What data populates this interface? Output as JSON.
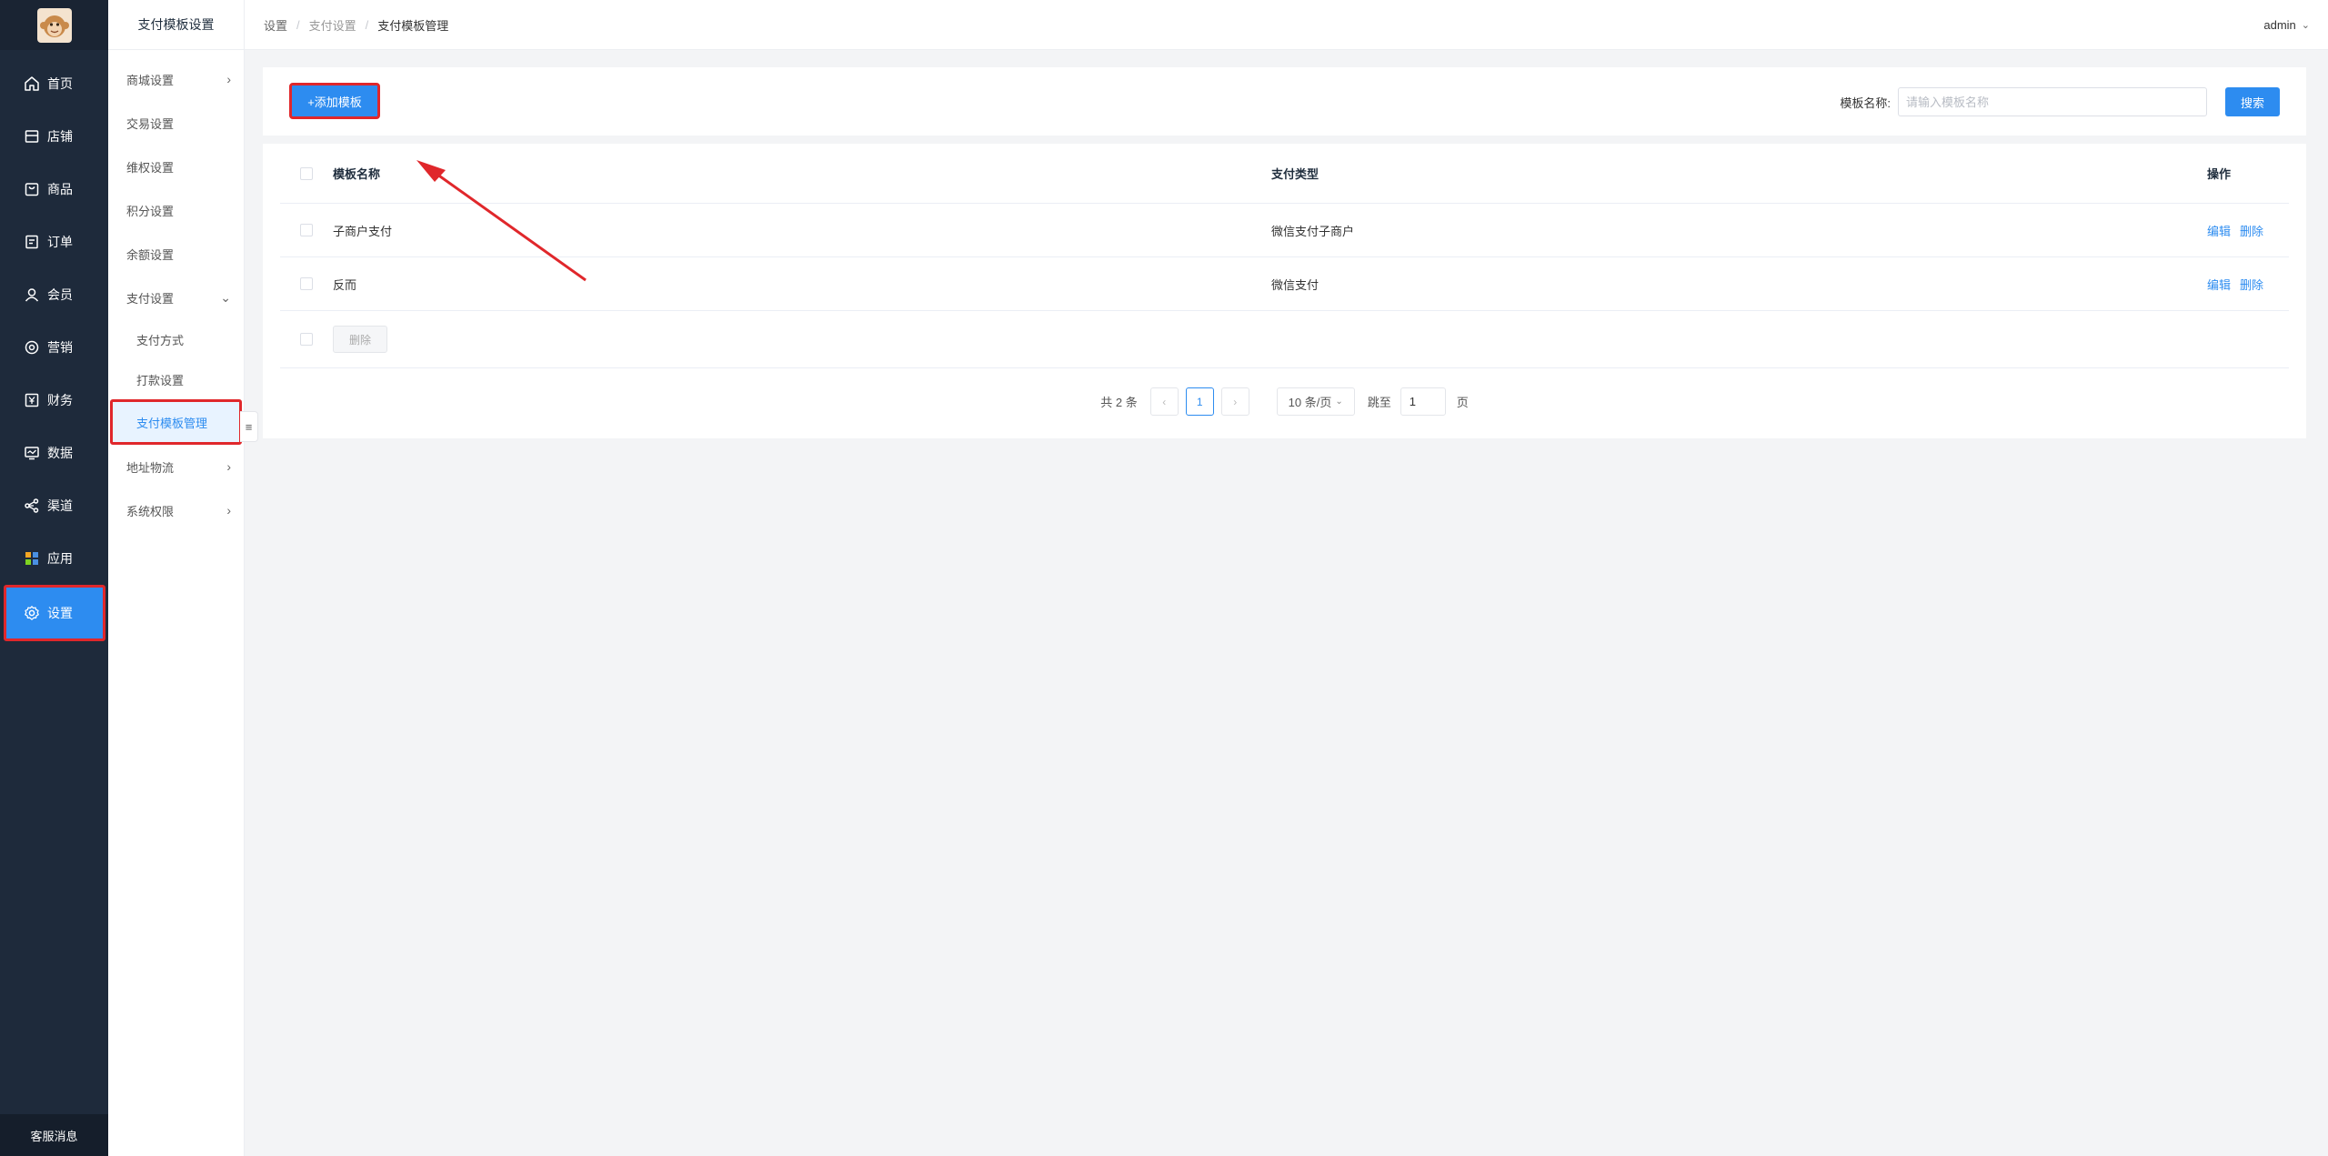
{
  "app": {
    "avatar_alt": "avatar",
    "footer_label": "客服消息"
  },
  "nav": {
    "items": [
      {
        "label": "首页",
        "icon": "home-icon"
      },
      {
        "label": "店铺",
        "icon": "store-icon"
      },
      {
        "label": "商品",
        "icon": "goods-icon"
      },
      {
        "label": "订单",
        "icon": "order-icon"
      },
      {
        "label": "会员",
        "icon": "member-icon"
      },
      {
        "label": "营销",
        "icon": "marketing-icon"
      },
      {
        "label": "财务",
        "icon": "finance-icon"
      },
      {
        "label": "数据",
        "icon": "data-icon"
      },
      {
        "label": "渠道",
        "icon": "channel-icon"
      },
      {
        "label": "应用",
        "icon": "apps-icon"
      },
      {
        "label": "设置",
        "icon": "settings-icon",
        "active": true
      }
    ]
  },
  "subnav": {
    "title": "支付模板设置",
    "items": [
      {
        "label": "商城设置",
        "chevron": "right"
      },
      {
        "label": "交易设置"
      },
      {
        "label": "维权设置"
      },
      {
        "label": "积分设置"
      },
      {
        "label": "余额设置"
      },
      {
        "label": "支付设置",
        "chevron": "down"
      }
    ],
    "children": [
      {
        "label": "支付方式"
      },
      {
        "label": "打款设置"
      },
      {
        "label": "支付模板管理",
        "active": true
      }
    ],
    "more": [
      {
        "label": "地址物流",
        "chevron": "right"
      },
      {
        "label": "系统权限",
        "chevron": "right"
      }
    ]
  },
  "header": {
    "breadcrumb": [
      "设置",
      "支付设置",
      "支付模板管理"
    ],
    "user": "admin"
  },
  "toolbar": {
    "add_label": "+添加模板",
    "search_label": "模板名称:",
    "search_placeholder": "请输入模板名称",
    "search_value": "",
    "search_button": "搜索"
  },
  "table": {
    "columns": [
      "模板名称",
      "支付类型",
      "操作"
    ],
    "rows": [
      {
        "name": "子商户支付",
        "type": "微信支付子商户",
        "ops": [
          "编辑",
          "删除"
        ]
      },
      {
        "name": "反而",
        "type": "微信支付",
        "ops": [
          "编辑",
          "删除"
        ]
      }
    ],
    "batch_delete": "删除"
  },
  "pagination": {
    "total": "共 2 条",
    "prev": "‹",
    "current": "1",
    "next": "›",
    "page_size": "10 条/页",
    "jump_label": "跳至",
    "jump_value": "1",
    "jump_unit": "页"
  },
  "colors": {
    "primary": "#2d8cf0",
    "nav_bg": "#1e2a3b",
    "highlight": "#e0272b"
  }
}
